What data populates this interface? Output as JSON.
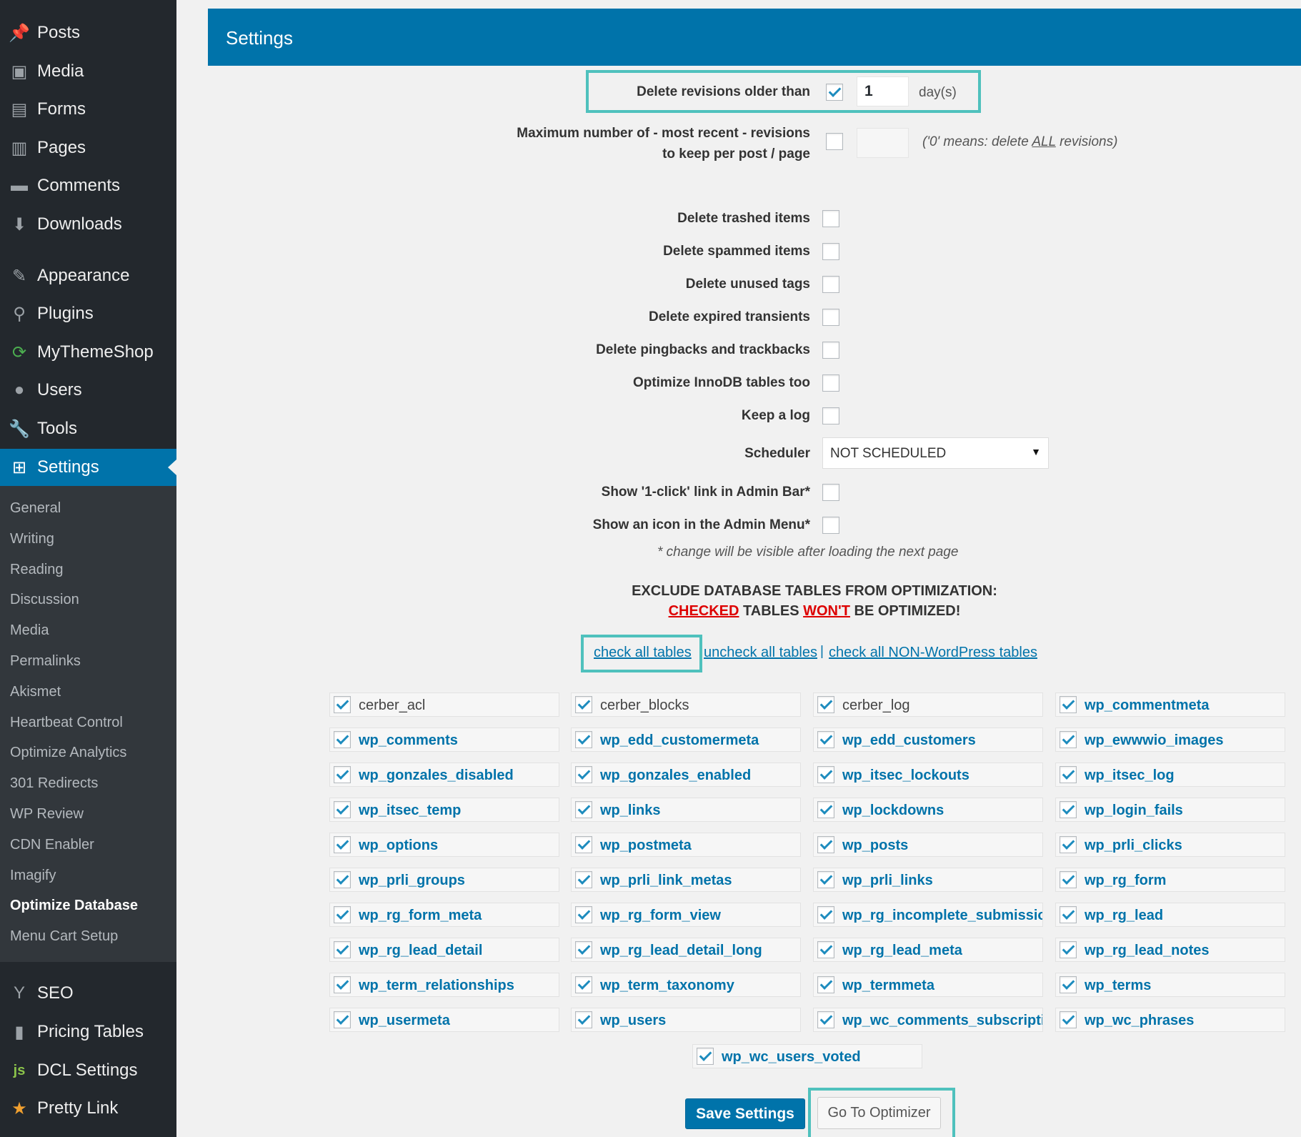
{
  "sidebar": {
    "main_items": [
      {
        "label": "Posts",
        "icon": "pin-icon"
      },
      {
        "label": "Media",
        "icon": "media-icon"
      },
      {
        "label": "Forms",
        "icon": "forms-icon"
      },
      {
        "label": "Pages",
        "icon": "pages-icon"
      },
      {
        "label": "Comments",
        "icon": "comment-icon"
      },
      {
        "label": "Downloads",
        "icon": "download-icon"
      },
      {
        "label": "Appearance",
        "icon": "brush-icon"
      },
      {
        "label": "Plugins",
        "icon": "plugin-icon"
      },
      {
        "label": "MyThemeShop",
        "icon": "refresh-icon"
      },
      {
        "label": "Users",
        "icon": "user-icon"
      },
      {
        "label": "Tools",
        "icon": "wrench-icon"
      },
      {
        "label": "Settings",
        "icon": "settings-icon"
      }
    ],
    "sub_items": [
      "General",
      "Writing",
      "Reading",
      "Discussion",
      "Media",
      "Permalinks",
      "Akismet",
      "Heartbeat Control",
      "Optimize Analytics",
      "301 Redirects",
      "WP Review",
      "CDN Enabler",
      "Imagify",
      "Optimize Database",
      "Menu Cart Setup"
    ],
    "bottom_items": [
      {
        "label": "SEO",
        "icon": "yoast-icon"
      },
      {
        "label": "Pricing Tables",
        "icon": "bar-chart-icon"
      },
      {
        "label": "DCL Settings",
        "icon": "js-icon"
      },
      {
        "label": "Pretty Link",
        "icon": "star-icon"
      }
    ]
  },
  "header": {
    "title": "Settings"
  },
  "revisions": {
    "delete_label": "Delete revisions older than",
    "delete_checked": true,
    "days_value": "1",
    "days_unit": "day(s)",
    "max_label_1": "Maximum number of - most recent - revisions",
    "max_label_2": "to keep per post / page",
    "max_value": "",
    "max_note_pre": "('0' means: delete ",
    "max_note_all": "ALL",
    "max_note_post": " revisions)"
  },
  "options": [
    {
      "label": "Delete trashed items",
      "checked": false
    },
    {
      "label": "Delete spammed items",
      "checked": false
    },
    {
      "label": "Delete unused tags",
      "checked": false
    },
    {
      "label": "Delete expired transients",
      "checked": false
    },
    {
      "label": "Delete pingbacks and trackbacks",
      "checked": false
    },
    {
      "label": "Optimize InnoDB tables too",
      "checked": false
    },
    {
      "label": "Keep a log",
      "checked": false
    }
  ],
  "scheduler": {
    "label": "Scheduler",
    "value": "NOT SCHEDULED",
    "arrow": "▼"
  },
  "admin": [
    {
      "label": "Show '1-click' link in Admin Bar*",
      "checked": false
    },
    {
      "label": "Show an icon in the Admin Menu*",
      "checked": false
    }
  ],
  "admin_note": "* change will be visible after loading the next page",
  "exclude": {
    "title": "EXCLUDE DATABASE TABLES FROM OPTIMIZATION:",
    "checked_word": "CHECKED",
    "tables_word": " TABLES ",
    "wont_word": "WON'T",
    "be_optimized": " BE OPTIMIZED!"
  },
  "links": {
    "check_all": "check all tables",
    "uncheck_all": "uncheck all tables",
    "separator": "|",
    "check_non_wp": "check all NON-WordPress tables"
  },
  "tables": [
    [
      "cerber_acl",
      "cerber_blocks",
      "cerber_log",
      "wp_commentmeta"
    ],
    [
      "wp_comments",
      "wp_edd_customermeta",
      "wp_edd_customers",
      "wp_ewwwio_images"
    ],
    [
      "wp_gonzales_disabled",
      "wp_gonzales_enabled",
      "wp_itsec_lockouts",
      "wp_itsec_log"
    ],
    [
      "wp_itsec_temp",
      "wp_links",
      "wp_lockdowns",
      "wp_login_fails"
    ],
    [
      "wp_options",
      "wp_postmeta",
      "wp_posts",
      "wp_prli_clicks"
    ],
    [
      "wp_prli_groups",
      "wp_prli_link_metas",
      "wp_prli_links",
      "wp_rg_form"
    ],
    [
      "wp_rg_form_meta",
      "wp_rg_form_view",
      "wp_rg_incomplete_submissions",
      "wp_rg_lead"
    ],
    [
      "wp_rg_lead_detail",
      "wp_rg_lead_detail_long",
      "wp_rg_lead_meta",
      "wp_rg_lead_notes"
    ],
    [
      "wp_term_relationships",
      "wp_term_taxonomy",
      "wp_termmeta",
      "wp_terms"
    ],
    [
      "wp_usermeta",
      "wp_users",
      "wp_wc_comments_subscriptions",
      "wp_wc_phrases"
    ]
  ],
  "last_table": "wp_wc_users_voted",
  "buttons": {
    "save": "Save Settings",
    "optimizer": "Go To Optimizer"
  },
  "colors": {
    "accent": "#0073aa",
    "highlight": "#4fc1bd",
    "warning": "#dd0000"
  }
}
